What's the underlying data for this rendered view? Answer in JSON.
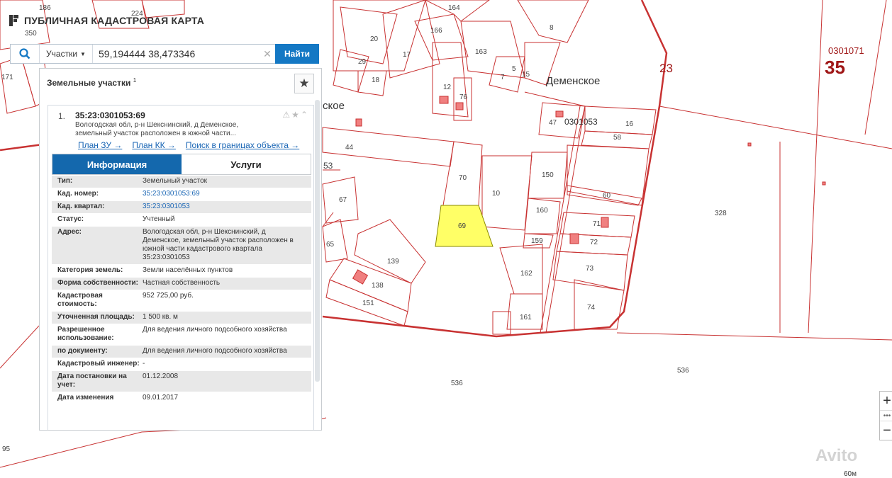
{
  "app": {
    "title": "ПУБЛИЧНАЯ КАДАСТРОВАЯ КАРТА"
  },
  "search": {
    "type_label": "Участки",
    "query": "59,194444 38,473346",
    "find_label": "Найти"
  },
  "panel": {
    "title": "Земельные участки",
    "title_count": "1",
    "item_number": "1.",
    "cad_number": "35:23:0301053:69",
    "description": "Вологодская обл, р-н Шекснинский, д Деменское, земельный участок расположен в южной части...",
    "links": [
      "План ЗУ →",
      "План КК →",
      "Поиск в границах объекта →"
    ],
    "tabs": {
      "info": "Информация",
      "services": "Услуги"
    },
    "attributes": [
      {
        "key": "Тип:",
        "value": "Земельный участок"
      },
      {
        "key": "Кад. номер:",
        "value": "35:23:0301053:69"
      },
      {
        "key": "Кад. квартал:",
        "value": "35:23:0301053"
      },
      {
        "key": "Статус:",
        "value": "Учтенный"
      },
      {
        "key": "Адрес:",
        "value": "Вологодская обл, р-н Шекснинский, д Деменское, земельный участок расположен в южной части кадастрового квартала 35:23:0301053"
      },
      {
        "key": "Категория земель:",
        "value": "Земли населённых пунктов"
      },
      {
        "key": "Форма собственности:",
        "value": "Частная собственность"
      },
      {
        "key": "Кадастровая стоимость:",
        "value": "952 725,00 руб."
      },
      {
        "key": "Уточненная площадь:",
        "value": "1 500 кв. м"
      },
      {
        "key": "Разрешенное использование:",
        "value": "Для ведения личного подсобного хозяйства"
      },
      {
        "key": "по документу:",
        "value": "Для ведения личного подсобного хозяйства"
      },
      {
        "key": "Кадастровый инженер:",
        "value": "-"
      },
      {
        "key": "Дата постановки на учет:",
        "value": "01.12.2008"
      },
      {
        "key": "Дата изменения",
        "value": "09.01.2017"
      }
    ]
  },
  "map": {
    "village_name": "Деменское",
    "village_name_partial": "ское",
    "quarter_label": "0301053",
    "district_code": "23",
    "region_quarter_code": "0301071",
    "region_number": "35",
    "parcel_labels": [
      "186",
      "224",
      "350",
      "20",
      "17",
      "166",
      "163",
      "164",
      "8",
      "29",
      "18",
      "5",
      "15",
      "7",
      "12",
      "76",
      "47",
      "16",
      "58",
      "44",
      "53",
      "70",
      "10",
      "150",
      "60",
      "67",
      "69",
      "71",
      "72",
      "160",
      "159",
      "65",
      "139",
      "162",
      "73",
      "138",
      "151",
      "74",
      "161",
      "328",
      "536",
      "536",
      "95",
      "171"
    ],
    "scale_label": "60м",
    "colors": {
      "parcel_line": "#c83232",
      "selected_fill": "#ffff66",
      "region_text": "#a01818"
    }
  },
  "watermark": "Avito"
}
